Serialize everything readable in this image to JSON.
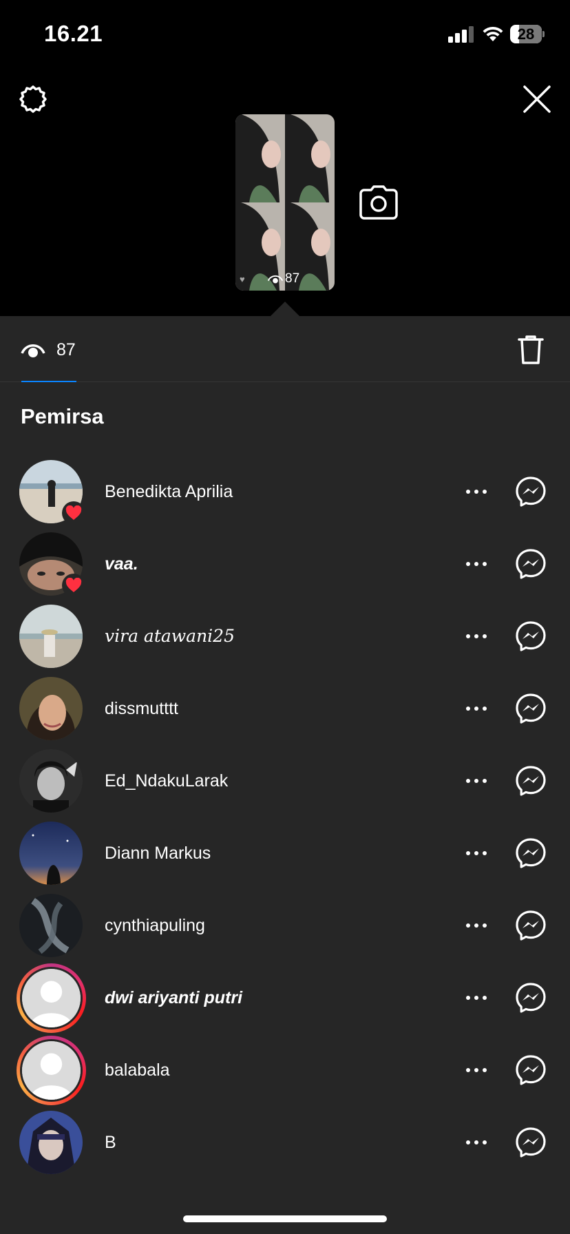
{
  "status_bar": {
    "time": "16.21",
    "battery_percent": "28",
    "battery_level": 0.28,
    "signal_bars": 3
  },
  "top_bar": {
    "settings_icon": "gear-icon",
    "close_icon": "close-icon",
    "camera_icon": "camera-icon"
  },
  "story_thumbnail": {
    "heart_glyph": "♥",
    "view_count": "87"
  },
  "viewers_tab": {
    "view_count": "87",
    "accent_color": "#0a84ff",
    "delete_icon": "trash-icon"
  },
  "section_title": "Pemirsa",
  "viewers": [
    {
      "name": "Benedikta Aprilia",
      "style": "normal",
      "liked": true,
      "avatar": "photo-beach"
    },
    {
      "name": "vaa.",
      "style": "italic",
      "liked": true,
      "avatar": "photo-face-dark"
    },
    {
      "name": "𝑣𝑖𝑟𝑎 𝑎𝑡𝑎𝑤𝑎𝑛𝑖25",
      "style": "serif",
      "liked": false,
      "avatar": "photo-beach-hat"
    },
    {
      "name": "dissmutttt",
      "style": "normal",
      "liked": false,
      "avatar": "photo-selfie"
    },
    {
      "name": "Ed_NdakuLarak",
      "style": "normal",
      "liked": false,
      "avatar": "photo-bw-portrait"
    },
    {
      "name": "Diann Markus",
      "style": "normal",
      "liked": false,
      "avatar": "photo-night-sky"
    },
    {
      "name": "cynthiapuling",
      "style": "normal",
      "liked": false,
      "avatar": "photo-abstract"
    },
    {
      "name": "dwi ariyanti putri",
      "style": "italic",
      "liked": false,
      "avatar": "default-avatar",
      "story_ring": true
    },
    {
      "name": "balabala",
      "style": "normal",
      "liked": false,
      "avatar": "default-avatar",
      "story_ring": true
    },
    {
      "name": "B",
      "style": "normal",
      "liked": false,
      "avatar": "photo-anime"
    }
  ],
  "row_actions": {
    "more_icon": "more-horizontal-icon",
    "message_icon": "messenger-icon"
  },
  "colors": {
    "sheet_background": "#262626",
    "like_red": "#ff3040",
    "story_ring_start": "#c13584",
    "story_ring_end": "#fcaf45"
  }
}
